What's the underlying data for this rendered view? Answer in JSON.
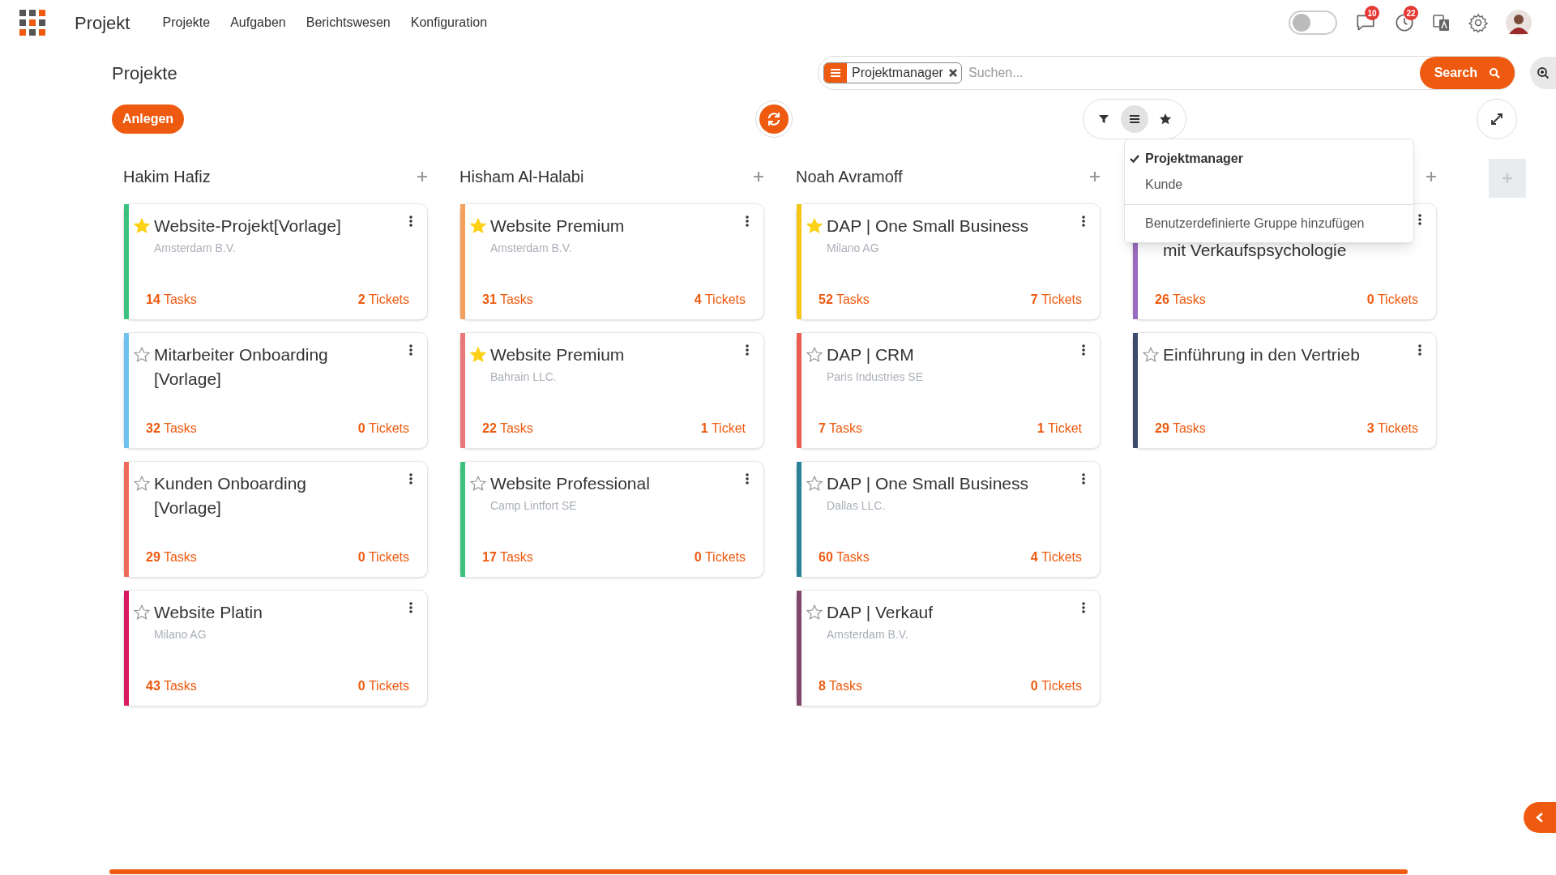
{
  "app_title": "Projekt",
  "nav": [
    "Projekte",
    "Aufgaben",
    "Berichtswesen",
    "Konfiguration"
  ],
  "toggle": {
    "on": false
  },
  "notifications": [
    {
      "kind": "chat",
      "badge": "10"
    },
    {
      "kind": "clock",
      "badge": "22"
    }
  ],
  "page_title": "Projekte",
  "create_button": "Anlegen",
  "search": {
    "facet": "Projektmanager",
    "placeholder": "Suchen...",
    "button": "Search"
  },
  "view_buttons": [
    {
      "kind": "filter",
      "selected": false
    },
    {
      "kind": "group",
      "selected": true
    },
    {
      "kind": "favorite",
      "selected": false
    }
  ],
  "group_menu": {
    "items": [
      {
        "label": "Projektmanager",
        "selected": true
      },
      {
        "label": "Kunde",
        "selected": false
      }
    ],
    "custom": "Benutzerdefinierte Gruppe hinzufügen"
  },
  "columns": [
    {
      "name": "Hakim Hafiz",
      "cards": [
        {
          "title": "Website-Projekt[Vorlage]",
          "customer": "Amsterdam B.V.",
          "starred": true,
          "color": "#3cc27e",
          "tasks": "**14** Tasks",
          "tickets": "**2** Tickets"
        },
        {
          "title": "Mitarbeiter Onboarding [Vorlage]",
          "starred": false,
          "color": "#6ec1ef",
          "tasks": "**32** Tasks",
          "tickets": "**0** Tickets"
        },
        {
          "title": "Kunden Onboarding [Vorlage]",
          "starred": false,
          "color": "#ef6a5a",
          "tasks": "**29** Tasks",
          "tickets": "**0** Tickets"
        },
        {
          "title": "Website Platin",
          "customer": "Milano AG",
          "starred": false,
          "color": "#d81b60",
          "tasks": "**43** Tasks",
          "tickets": "**0** Tickets"
        }
      ]
    },
    {
      "name": "Hisham Al-Halabi",
      "cards": [
        {
          "title": "Website Premium",
          "customer": "Amsterdam B.V.",
          "starred": true,
          "color": "#f2a05c",
          "tasks": "**31** Tasks",
          "tickets": "**4** Tickets"
        },
        {
          "title": "Website Premium",
          "customer": "Bahrain LLC.",
          "starred": true,
          "color": "#e8777a",
          "tasks": "**22** Tasks",
          "tickets": "**1** Ticket"
        },
        {
          "title": "Website Professional",
          "customer": "Camp Lintfort SE",
          "starred": false,
          "color": "#3cc27e",
          "tasks": "**17** Tasks",
          "tickets": "**0** Tickets"
        }
      ]
    },
    {
      "name": "Noah Avramoff",
      "cards": [
        {
          "title": "DAP | One Small Business",
          "customer": "Milano AG",
          "starred": true,
          "color": "#f5c518",
          "tasks": "**52** Tasks",
          "tickets": "**7** Tickets"
        },
        {
          "title": "DAP | CRM",
          "customer": "Paris Industries SE",
          "starred": false,
          "color": "#ea5d4f",
          "tasks": "**7** Tasks",
          "tickets": "**1** Ticket"
        },
        {
          "title": "DAP | One Small Business",
          "customer": "Dallas LLC.",
          "starred": false,
          "color": "#2b8296",
          "tasks": "**60** Tasks",
          "tickets": "**4** Tickets"
        },
        {
          "title": "DAP | Verkauf",
          "customer": "Amsterdam B.V.",
          "starred": false,
          "color": "#7f4a69",
          "tasks": "**8** Tasks",
          "tickets": "**0** Tickets"
        }
      ]
    },
    {
      "cards": [
        {
          "kind": "covered",
          "title": "mit Verkaufspsychologie",
          "color": "#9b6bc0",
          "tasks": "**26** Tasks",
          "tickets": "**0** Tickets"
        },
        {
          "title": "Einführung in den Vertrieb",
          "starred": false,
          "color": "#3d4a6e",
          "tasks": "**29** Tasks",
          "tickets": "**3** Tickets"
        }
      ]
    }
  ]
}
